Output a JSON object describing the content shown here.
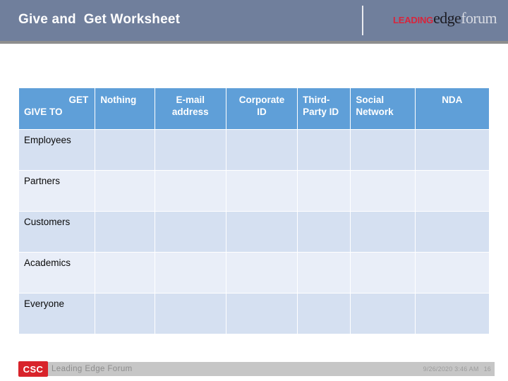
{
  "header": {
    "title": "Give and  Get Worksheet",
    "background_color": "#707f9c",
    "brand": {
      "part1": "LEADING",
      "part2": "edge",
      "part3": "forum",
      "part1_color": "#d8253c",
      "part2_color": "#1b1b22",
      "part3_color": "#d7dae2"
    }
  },
  "table": {
    "header_color": "#5f9fd8",
    "row_dark_color": "#d5e0f1",
    "row_light_color": "#e9eef8",
    "corner": {
      "get_label": "GET",
      "give_to_label": "GIVE TO"
    },
    "columns": [
      {
        "label": "Nothing",
        "align": "left"
      },
      {
        "label": "E-mail\naddress",
        "align": "center"
      },
      {
        "label": "Corporate\nID",
        "align": "center"
      },
      {
        "label": "Third-\nParty ID",
        "align": "center"
      },
      {
        "label": "Social\nNetwork",
        "align": "left"
      },
      {
        "label": "NDA",
        "align": "center"
      }
    ],
    "column_labels": {
      "c1": "Nothing",
      "c2_line1": "E-mail",
      "c2_line2": "address",
      "c3_line1": "Corporate",
      "c3_line2": "ID",
      "c4_line1": "Third-",
      "c4_line2": "Party ID",
      "c5_line1": "Social",
      "c5_line2": "Network",
      "c6": "NDA"
    },
    "rows": [
      {
        "label": "Employees",
        "cells": [
          "",
          "",
          "",
          "",
          "",
          ""
        ]
      },
      {
        "label": "Partners",
        "cells": [
          "",
          "",
          "",
          "",
          "",
          ""
        ]
      },
      {
        "label": "Customers",
        "cells": [
          "",
          "",
          "",
          "",
          "",
          ""
        ]
      },
      {
        "label": "Academics",
        "cells": [
          "",
          "",
          "",
          "",
          "",
          ""
        ]
      },
      {
        "label": "Everyone",
        "cells": [
          "",
          "",
          "",
          "",
          "",
          ""
        ]
      }
    ]
  },
  "footer": {
    "logo_text": "CSC",
    "logo_color": "#d8232a",
    "caption": "Leading Edge Forum",
    "timestamp": "9/26/2020 3:46 AM",
    "slide_number": "16"
  }
}
